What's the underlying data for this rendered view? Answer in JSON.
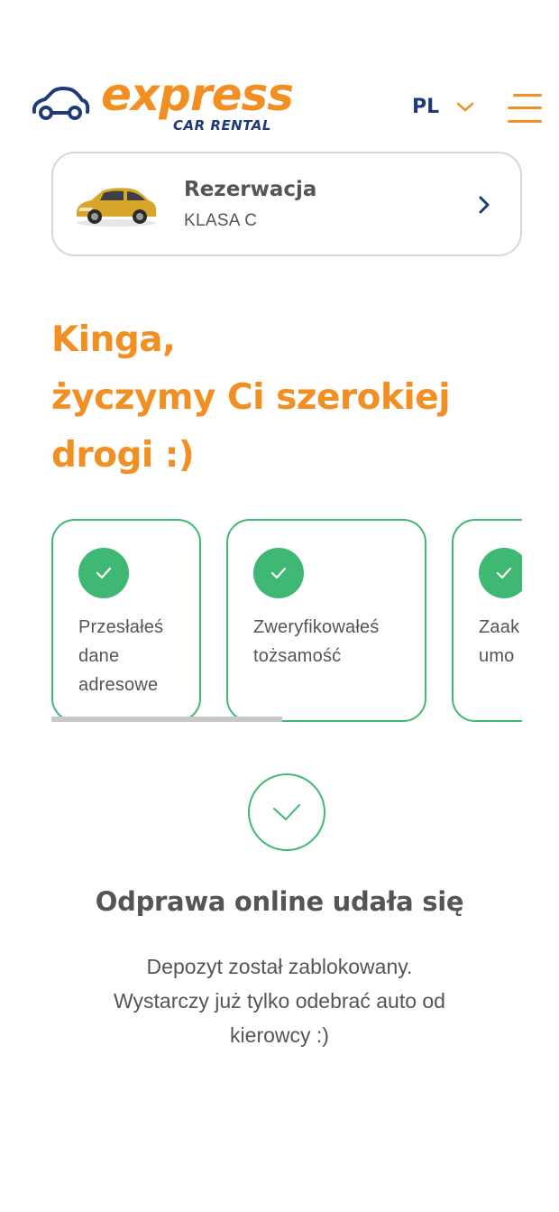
{
  "header": {
    "logo_word": "express",
    "logo_sub": "CAR RENTAL",
    "language": "PL",
    "brand_orange": "#f28f22",
    "brand_navy": "#1f3a78"
  },
  "reservation": {
    "title": "Rezerwacja",
    "car_class": "KLASA C"
  },
  "greeting": {
    "line1": "Kinga,",
    "line2": "życzymy Ci szerokiej",
    "line3": "drogi :)"
  },
  "steps": [
    {
      "text": "Przesłałeś\ndane\nadresowe",
      "done": true
    },
    {
      "text": "Zweryfikowałeś\ntożsamość",
      "done": true
    },
    {
      "text": "Zaak\numo",
      "done": true
    }
  ],
  "steps_scroll_progress": 0.49,
  "success": {
    "title": "Odprawa online udała się",
    "desc_line1": "Depozyt został zablokowany.",
    "desc_line2": "Wystarczy już tylko odebrać auto od",
    "desc_line3": "kierowcy :)",
    "success_color": "#3fb873"
  }
}
